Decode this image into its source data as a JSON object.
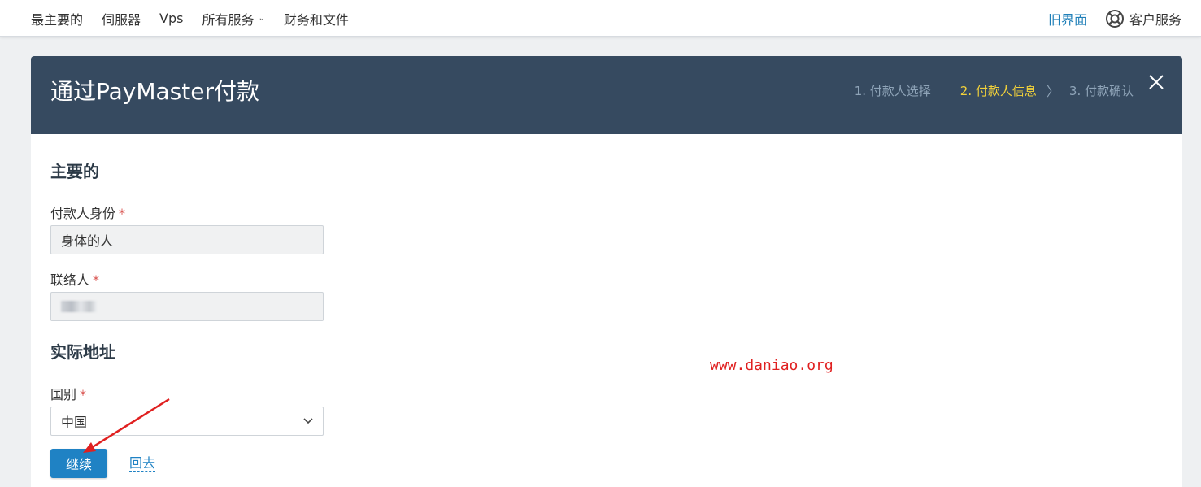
{
  "nav": {
    "items": [
      {
        "label": "最主要的"
      },
      {
        "label": "伺服器"
      },
      {
        "label": "Vps"
      },
      {
        "label": "所有服务",
        "has_dropdown": true
      },
      {
        "label": "财务和文件"
      }
    ],
    "old_ui": "旧界面",
    "support": "客户服务"
  },
  "modal": {
    "title": "通过PayMaster付款",
    "steps": [
      "1. 付款人选择",
      "2. 付款人信息",
      "3. 付款确认"
    ],
    "active_step": 2,
    "step_sep": "〉"
  },
  "form": {
    "section_main": "主要的",
    "payer_status_label": "付款人身份",
    "payer_status_value": "身体的人",
    "contact_label": "联络人",
    "section_address": "实际地址",
    "country_label": "国别",
    "country_value": "中国",
    "required_mark": "*",
    "continue_label": "继续",
    "back_label": "回去"
  },
  "watermark": "www.daniao.org",
  "colors": {
    "header_bg": "#364a60",
    "active_step": "#f3d23a",
    "primary": "#1f82c4",
    "link": "#1f7fb8",
    "annotation": "#e02020"
  }
}
